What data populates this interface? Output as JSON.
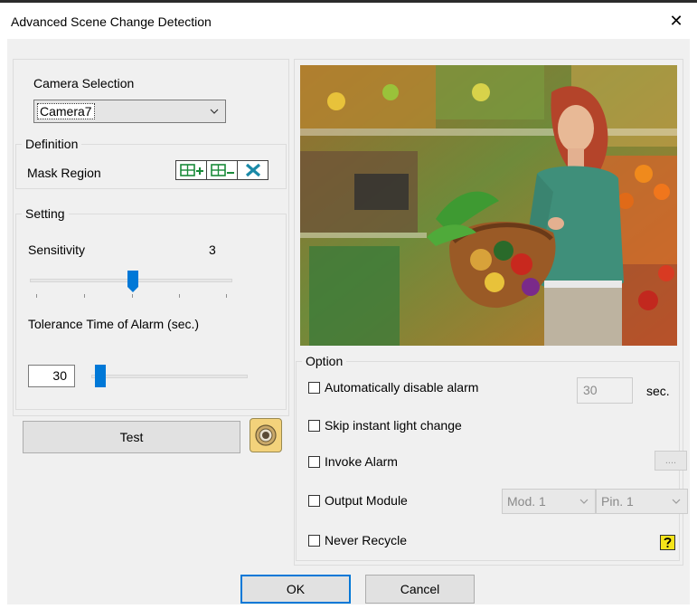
{
  "window": {
    "title": "Advanced Scene Change Detection",
    "close_glyph": "✕"
  },
  "camera": {
    "label": "Camera Selection",
    "selected": "Camera7"
  },
  "definition": {
    "group_label": "Definition",
    "mask_label": "Mask Region",
    "tools": [
      "add-mask-icon",
      "remove-mask-icon",
      "clear-mask-icon"
    ]
  },
  "setting": {
    "group_label": "Setting",
    "sensitivity_label": "Sensitivity",
    "sensitivity_value": "3",
    "sensitivity_min": 1,
    "sensitivity_max": 5,
    "tolerance_label": "Tolerance Time of Alarm (sec.)",
    "tolerance_value": "30"
  },
  "test": {
    "label": "Test",
    "icon": "camera-lens-icon"
  },
  "option": {
    "group_label": "Option",
    "auto_disable": {
      "label": "Automatically disable alarm",
      "checked": false,
      "seconds": "30",
      "unit": "sec."
    },
    "skip_light": {
      "label": "Skip instant light change",
      "checked": false
    },
    "invoke_alarm": {
      "label": "Invoke Alarm",
      "checked": false,
      "browse_label": "...."
    },
    "output_module": {
      "label": "Output Module",
      "checked": false,
      "module": "Mod. 1",
      "pin": "Pin. 1"
    },
    "never_recycle": {
      "label": "Never Recycle",
      "checked": false
    },
    "help_icon": "help-icon"
  },
  "footer": {
    "ok_label": "OK",
    "cancel_label": "Cancel"
  },
  "colors": {
    "accent": "#0078d7",
    "panel_bg": "#f0f0f0",
    "mask_icon_green": "#1a8a3a"
  }
}
